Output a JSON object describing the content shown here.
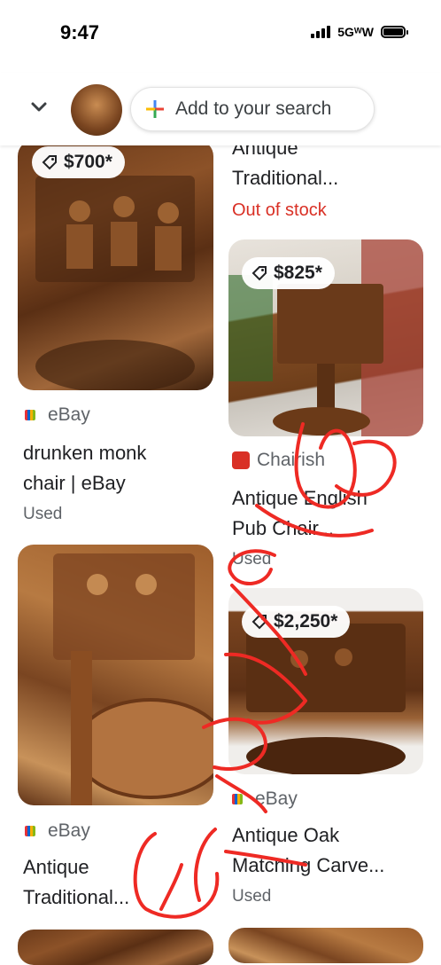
{
  "status_bar": {
    "time": "9:47",
    "network": "5GᵂW"
  },
  "search_header": {
    "add_label": "Add to your search"
  },
  "left_column": [
    {
      "price": "$700*",
      "source": "eBay",
      "title_line1": "drunken monk",
      "title_line2": "chair | eBay",
      "condition": "Used"
    },
    {
      "source": "eBay",
      "title_line1": "Antique",
      "title_line2": "Traditional..."
    }
  ],
  "right_column": [
    {
      "title_line1": "Antique",
      "title_line2": "Traditional...",
      "stock": "Out of stock"
    },
    {
      "price": "$825*",
      "source": "Chairish",
      "title_line1": "Antique English",
      "title_line2": "Pub Chair...",
      "condition": "Used"
    },
    {
      "price": "$2,250*",
      "source": "eBay",
      "title_line1": "Antique Oak",
      "title_line2": "Matching Carve...",
      "condition": "Used"
    }
  ],
  "colors": {
    "out_of_stock": "#d93025",
    "scribble": "#ee2a24"
  }
}
